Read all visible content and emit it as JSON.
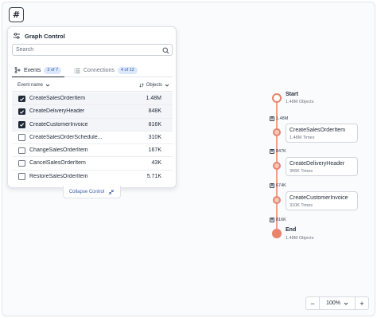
{
  "toolbar": {
    "hash_icon": "hash-icon",
    "hash_label": "#"
  },
  "panel": {
    "title": "Graph Control",
    "search": {
      "placeholder": "Search",
      "value": ""
    },
    "tabs": [
      {
        "label": "Events",
        "badge": "3 of 7",
        "active": true
      },
      {
        "label": "Connections",
        "badge": "4 of 12",
        "active": false
      }
    ],
    "columns": {
      "name": "Event name",
      "objects": "Objects"
    },
    "rows": [
      {
        "name": "CreateSalesOrderItem",
        "count": "1.48M",
        "checked": true
      },
      {
        "name": "CreateDeliveryHeader",
        "count": "848K",
        "checked": true
      },
      {
        "name": "CreateCustomerInvoice",
        "count": "816K",
        "checked": true
      },
      {
        "name": "CreateSalesOrderSchedule...",
        "count": "310K",
        "checked": false
      },
      {
        "name": "ChangeSalesOrderItem",
        "count": "167K",
        "checked": false
      },
      {
        "name": "CancelSalesOrderItem",
        "count": "43K",
        "checked": false
      },
      {
        "name": "RestoreSalesOrderItem",
        "count": "5.71K",
        "checked": false
      }
    ],
    "collapse_label": "Collapse Control"
  },
  "graph": {
    "start": {
      "label": "Start",
      "sub": "1.48M Objects"
    },
    "edges": [
      "1.48M",
      "847K",
      "674K",
      "816K"
    ],
    "events": [
      {
        "title": "CreateSalesOrderItem",
        "sub": "1.48M Times"
      },
      {
        "title": "CreateDeliveryHeader",
        "sub": "356K Times"
      },
      {
        "title": "CreateCustomerInvoice",
        "sub": "310K Times"
      }
    ],
    "end": {
      "label": "End",
      "sub": "1.48M Objects"
    }
  },
  "zoom": {
    "minus": "−",
    "value": "100%",
    "plus": "+"
  },
  "colors": {
    "accent": "#e8836a",
    "badge_bg": "#dbe7fb",
    "badge_text": "#3b5ea8"
  }
}
